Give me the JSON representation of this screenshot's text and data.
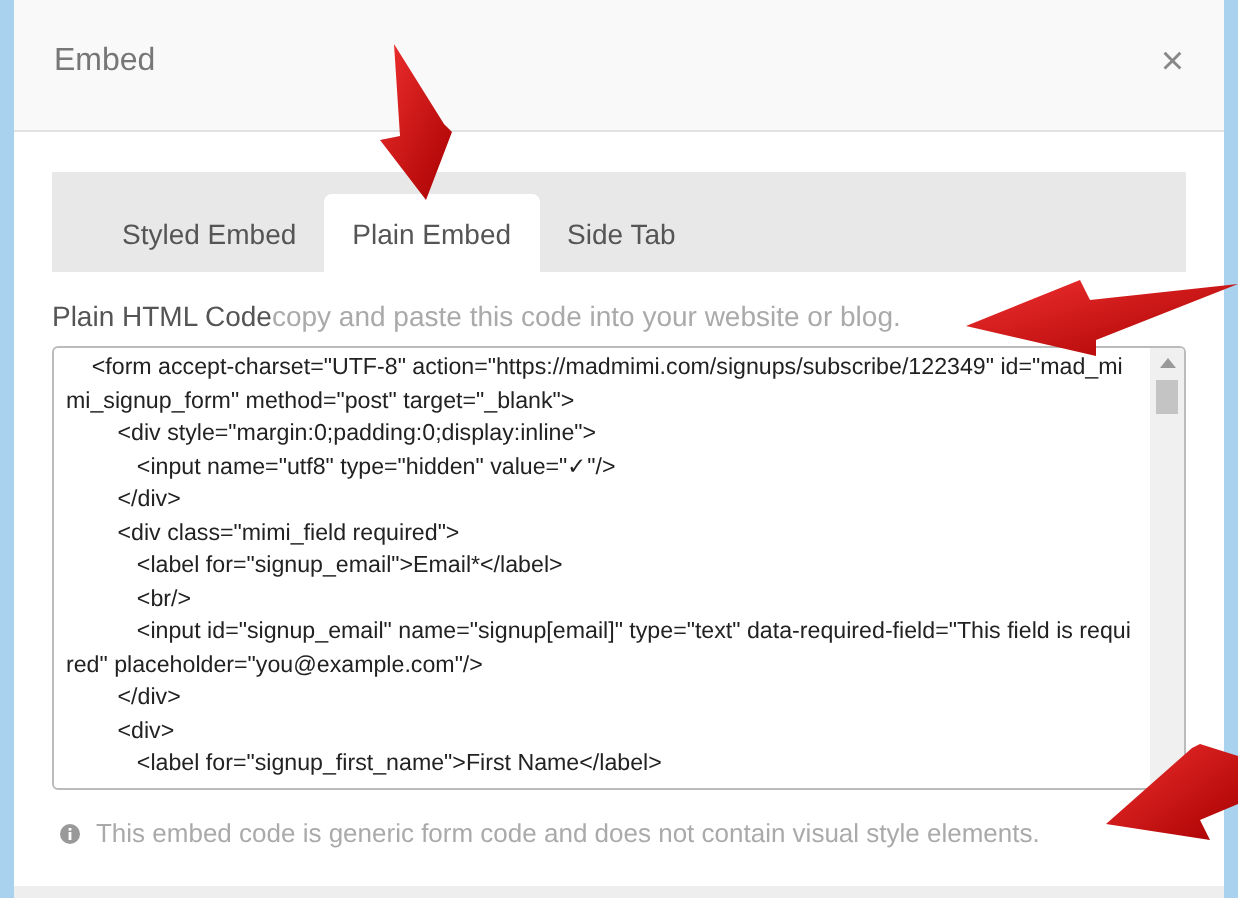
{
  "dialog": {
    "title": "Embed",
    "close": "×"
  },
  "tabs": [
    {
      "label": "Styled Embed",
      "selected": false
    },
    {
      "label": "Plain Embed",
      "selected": true
    },
    {
      "label": "Side Tab",
      "selected": false
    }
  ],
  "code_section": {
    "label": "Plain HTML Code",
    "hint": "copy and paste this code into your website or blog.",
    "lines": [
      "    <form accept-charset=\"UTF-8\" action=\"https://madmimi.com/signups/subscribe/122349\" id=\"mad_mimi_signup_form\" method=\"post\" target=\"_blank\">",
      "        <div style=\"margin:0;padding:0;display:inline\">",
      "           <input name=\"utf8\" type=\"hidden\" value=\"✓\"/>",
      "        </div>",
      "        <div class=\"mimi_field required\">",
      "           <label for=\"signup_email\">Email*</label>",
      "           <br/>",
      "           <input id=\"signup_email\" name=\"signup[email]\" type=\"text\" data-required-field=\"This field is required\" placeholder=\"you@example.com\"/>",
      "        </div>",
      "        <div>",
      "           <label for=\"signup_first_name\">First Name</label>"
    ]
  },
  "note": "This embed code is generic form code and does not contain visual style elements."
}
